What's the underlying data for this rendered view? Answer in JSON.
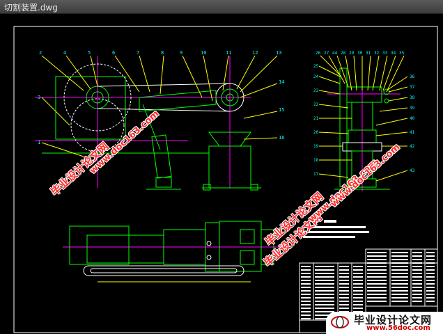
{
  "window": {
    "title": "切割装置.dwg"
  },
  "colors": {
    "background": "#000000",
    "outline": "#00ff00",
    "frame": "#ffffff",
    "leader": "#ffff00",
    "center": "#ff00ff",
    "label": "#00ffff",
    "watermark": "#ff2a2a"
  },
  "watermarks": [
    {
      "text": "毕业设计论文网"
    },
    {
      "text": "www.doc163.com"
    },
    {
      "text": "毕业设计论文网"
    },
    {
      "text": "www.doc163.com"
    },
    {
      "text": "毕业设计论文网"
    },
    {
      "text": "www.doc163.com"
    }
  ],
  "banner": {
    "cn": "毕业设计论文网",
    "url": "www.56doc.com"
  },
  "front_view_labels": [
    "1",
    "2",
    "3",
    "4",
    "5",
    "6",
    "7",
    "8",
    "9",
    "10",
    "11",
    "12",
    "13",
    "14",
    "15",
    "16"
  ],
  "side_view_labels": [
    "17",
    "18",
    "19",
    "20",
    "21",
    "22",
    "23",
    "24",
    "25",
    "26",
    "27",
    "28",
    "29",
    "30",
    "31",
    "32",
    "33",
    "34",
    "35",
    "36",
    "37",
    "38",
    "39",
    "40",
    "41",
    "42",
    "43",
    "44"
  ]
}
